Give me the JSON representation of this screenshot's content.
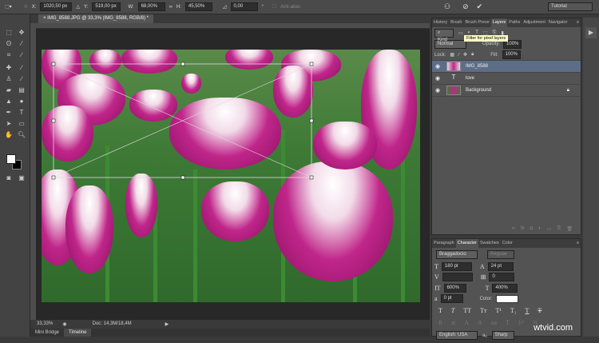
{
  "options_bar": {
    "x_label": "X:",
    "x": "1020,50 px",
    "y_label": "Y:",
    "y": "519,00 px",
    "w_label": "W:",
    "w": "68,00%",
    "h_label": "H:",
    "h": "45,50%",
    "angle": "0,00",
    "anti_alias": "Anti-alias",
    "workspace": "Tutorial"
  },
  "document": {
    "tab_title": "IMG_8588.JPG @ 33,3% (IMG_8588, RGB/8) *"
  },
  "status": {
    "zoom": "33,33%",
    "doc": "Doc: 14,3M/18,4M"
  },
  "bottom_tabs": [
    "Mini Bridge",
    "Timeline"
  ],
  "layers_panel": {
    "tabs": [
      "History",
      "Brush",
      "Brush Prese",
      "Layers",
      "Paths",
      "Adjustment",
      "Navigator"
    ],
    "active_tab": "Layers",
    "kind": "Kind",
    "tooltip": "Filter for pixel layers",
    "blend_mode": "Normal",
    "opacity_label": "Opacity:",
    "opacity": "100%",
    "lock_label": "Lock:",
    "fill_label": "Fill:",
    "fill": "100%",
    "layers": [
      {
        "name": "IMG_8588",
        "selected": true
      },
      {
        "name": "love",
        "type": "text"
      },
      {
        "name": "Background",
        "locked": true
      }
    ]
  },
  "character_panel": {
    "tabs": [
      "Paragraph",
      "Character",
      "Swatches",
      "Color"
    ],
    "active_tab": "Character",
    "font": "Braggadocio",
    "style": "Regular",
    "size": "180 pt",
    "leading": "24 pt",
    "kerning": "",
    "tracking": "0",
    "vscale": "600%",
    "hscale": "400%",
    "baseline": "0 pt",
    "color_label": "Color:",
    "language": "English: USA",
    "aa_label": "aₐ",
    "antialias": "Sharp"
  },
  "watermark": "wtvid.com"
}
